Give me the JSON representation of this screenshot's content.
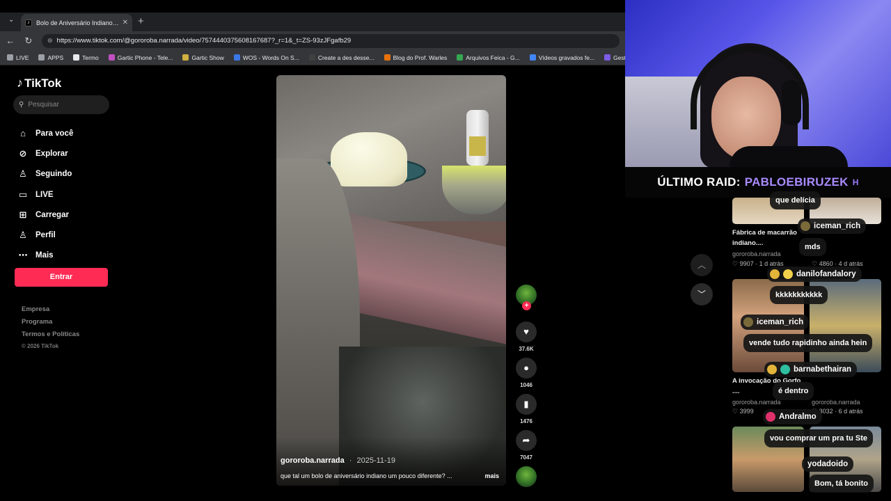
{
  "browser": {
    "tab_title": "Bolo de Aniversário Indiano: Uma",
    "url": "https://www.tiktok.com/@gororoba.narrada/video/7574440375608167687?_r=1&_t=ZS-93zJFgafb29",
    "bookmarks": [
      "LIVE",
      "APPS",
      "Termo",
      "Gartic Phone - Tele...",
      "Gartic Show",
      "WOS - Words On S...",
      "Create a des desse...",
      "Blog do Prof. Warles",
      "Arquivos Feica - G...",
      "Vídeos gravados fe...",
      "Gestão Mu"
    ],
    "bookmark_colors": [
      "#9aa0a6",
      "#9aa0a6",
      "#e8eaed",
      "#c050c0",
      "#d0b040",
      "#3b78e7",
      "#404040",
      "#e8710a",
      "#34a853",
      "#4285f4",
      "#7b5ce5"
    ]
  },
  "tiktok": {
    "logo": "TikTok",
    "search_placeholder": "Pesquisar",
    "nav": [
      {
        "icon": "home-icon",
        "glyph": "⌂",
        "label": "Para você"
      },
      {
        "icon": "compass-icon",
        "glyph": "⊘",
        "label": "Explorar"
      },
      {
        "icon": "following-icon",
        "glyph": "♙",
        "label": "Seguindo"
      },
      {
        "icon": "live-icon",
        "glyph": "▭",
        "label": "LIVE"
      },
      {
        "icon": "upload-icon",
        "glyph": "⊞",
        "label": "Carregar"
      },
      {
        "icon": "profile-icon",
        "glyph": "♙",
        "label": "Perfil"
      },
      {
        "icon": "more-icon",
        "glyph": "⋯",
        "label": "Mais"
      }
    ],
    "login_label": "Entrar",
    "footer": [
      "Empresa",
      "Programa",
      "Termos e Políticas",
      "© 2026 TikTok"
    ]
  },
  "video": {
    "author": "gororoba.narrada",
    "date": "2025-11-19",
    "caption": "que tal um bolo de aniversário indiano um pouco diferente? ...",
    "more_label": "mais",
    "likes": "37.6K",
    "comments": "1046",
    "saves": "1476",
    "shares": "7047"
  },
  "stream": {
    "raid_label": "ÚLTIMO RAID:",
    "raid_name": "PABLOEBIRUZEK",
    "raid_suffix": "H"
  },
  "related": [
    {
      "title": "Fábrica de macarrão indiano....",
      "author": "gororoba.narrada",
      "likes": "9907",
      "age": "1 d atrás"
    },
    {
      "title": "",
      "author": "",
      "likes": "4860",
      "age": "4 d atrás"
    },
    {
      "title": "A invocação do Gorfo ....",
      "author": "gororoba.narrada",
      "likes": "3999",
      "age": ""
    },
    {
      "title": "",
      "author": "gororoba.narrada",
      "likes": "3032",
      "age": "6 d atrás"
    }
  ],
  "chat": [
    {
      "user": "",
      "msg": "que delícia"
    },
    {
      "user": "iceman_rich",
      "msg": "mds"
    },
    {
      "user": "danilofandalory",
      "msg": "kkkkkkkkkkk"
    },
    {
      "user": "iceman_rich",
      "msg": "vende tudo rapidinho ainda hein"
    },
    {
      "user": "barnabethairan",
      "msg": "é dentro"
    },
    {
      "user": "Andralmo",
      "msg": "vou comprar um pra tu Ste"
    },
    {
      "user": "yodadoido",
      "msg": "Bom, tá bonito"
    }
  ]
}
